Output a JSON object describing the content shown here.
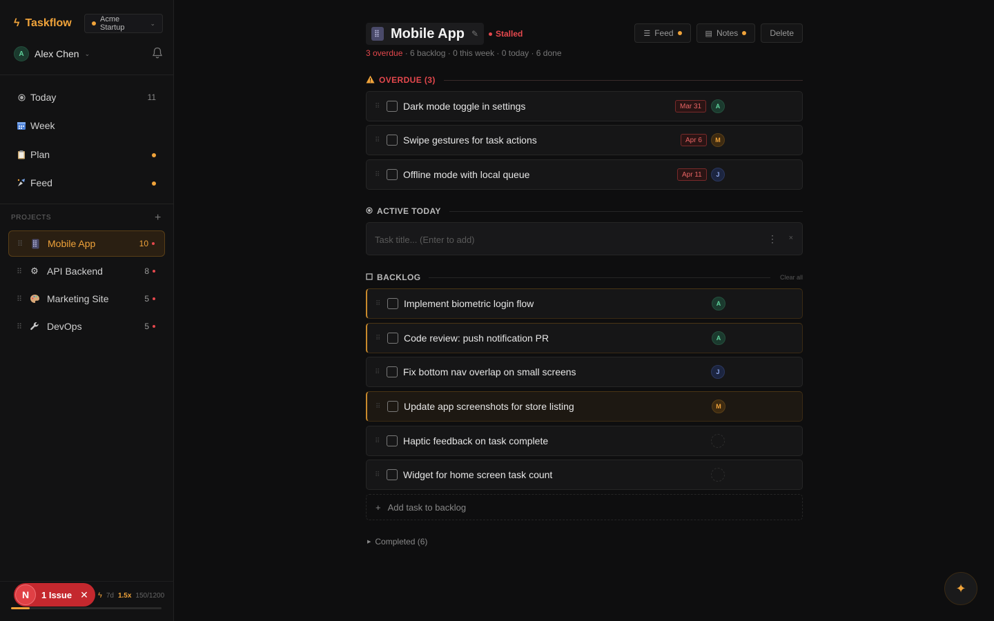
{
  "app": {
    "name": "Taskflow",
    "workspace": "Acme Startup"
  },
  "user": {
    "name": "Alex Chen",
    "initial": "A"
  },
  "nav": [
    {
      "label": "Today",
      "icon": "today-icon",
      "count": "11"
    },
    {
      "label": "Week",
      "icon": "calendar-icon",
      "count": ""
    },
    {
      "label": "Plan",
      "icon": "clipboard-icon",
      "count": ""
    },
    {
      "label": "Feed",
      "icon": "feed-icon",
      "count": ""
    }
  ],
  "projects_header": "PROJECTS",
  "projects": [
    {
      "name": "Mobile App",
      "icon": "phone-icon",
      "count": "10",
      "active": true
    },
    {
      "name": "API Backend",
      "icon": "gear-icon",
      "count": "8"
    },
    {
      "name": "Marketing Site",
      "icon": "palette-icon",
      "count": "5"
    },
    {
      "name": "DevOps",
      "icon": "wrench-icon",
      "count": "5"
    }
  ],
  "footer": {
    "issue_initial": "N",
    "issue_label": "1 Issue",
    "streak": "7d",
    "multiplier": "1.5x",
    "xp": "150/1200",
    "xp_fraction": 0.125
  },
  "header": {
    "title": "Mobile App",
    "status": "Stalled",
    "stats": {
      "overdue": "3 overdue",
      "rest": " · 6 backlog · 0 this week · 0 today · 6 done"
    },
    "actions": {
      "feed": "Feed",
      "notes": "Notes",
      "delete": "Delete"
    }
  },
  "sections": {
    "overdue": "OVERDUE (3)",
    "active": "ACTIVE TODAY",
    "backlog": "BACKLOG",
    "clear_all": "Clear all"
  },
  "overdue_tasks": [
    {
      "title": "Dark mode toggle in settings",
      "date": "Mar 31",
      "assignee": "A"
    },
    {
      "title": "Swipe gestures for task actions",
      "date": "Apr 6",
      "assignee": "M"
    },
    {
      "title": "Offline mode with local queue",
      "date": "Apr 11",
      "assignee": "J"
    }
  ],
  "input": {
    "placeholder": "Task title... (Enter to add)"
  },
  "backlog_tasks": [
    {
      "title": "Implement biometric login flow",
      "assignee": "A"
    },
    {
      "title": "Code review: push notification PR",
      "assignee": "A"
    },
    {
      "title": "Fix bottom nav overlap on small screens",
      "assignee": "J"
    },
    {
      "title": "Update app screenshots for store listing",
      "assignee": "M"
    },
    {
      "title": "Haptic feedback on task complete",
      "assignee": ""
    },
    {
      "title": "Widget for home screen task count",
      "assignee": ""
    }
  ],
  "add_backlog": "Add task to backlog",
  "completed": "Completed (6)",
  "colors": {
    "accent": "#f0a33a",
    "danger": "#e5484d",
    "bg": "#0e0e0f"
  }
}
